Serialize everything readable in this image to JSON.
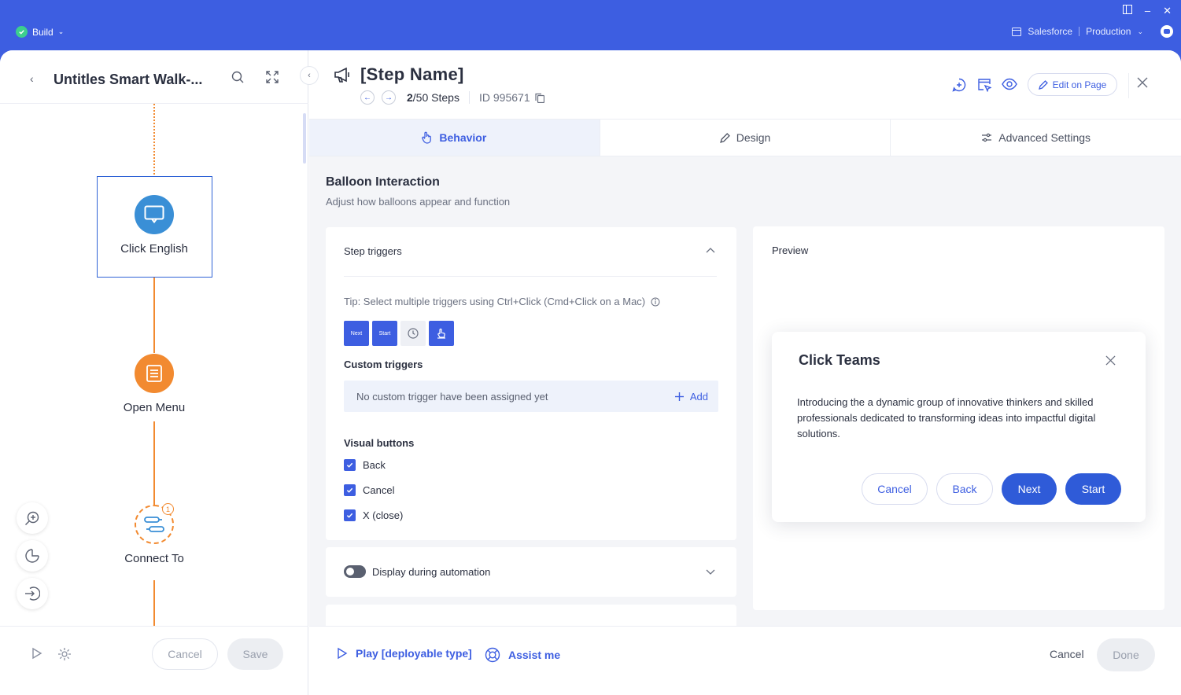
{
  "window": {
    "mode_label": "Build",
    "system_label": "Salesforce",
    "environment_label": "Production"
  },
  "left": {
    "title": "Untitles Smart Walk-...",
    "nodes": [
      {
        "label": "Click English",
        "icon": "balloon-icon"
      },
      {
        "label": "Open Menu",
        "icon": "list-icon"
      },
      {
        "label": "Connect To",
        "icon": "connector-icon",
        "badge": "1"
      }
    ],
    "footer": {
      "cancel": "Cancel",
      "save": "Save"
    }
  },
  "step": {
    "name": "[Step Name]",
    "current": "2",
    "total_label": "/50 Steps",
    "id_label": "ID 995671",
    "edit_on_page": "Edit on Page"
  },
  "tabs": [
    {
      "label": "Behavior",
      "active": true
    },
    {
      "label": "Design",
      "active": false
    },
    {
      "label": "Advanced Settings",
      "active": false
    }
  ],
  "section": {
    "title": "Balloon Interaction",
    "subtitle": "Adjust how balloons appear and function"
  },
  "step_triggers": {
    "title": "Step triggers",
    "tip": "Tip: Select multiple triggers using Ctrl+Click (Cmd+Click on a Mac)",
    "buttons": [
      {
        "label": "Next",
        "selected": true
      },
      {
        "label": "Start",
        "selected": true
      },
      {
        "label": "",
        "icon": "clock-icon",
        "selected": false
      },
      {
        "label": "",
        "icon": "click-element-icon",
        "selected": true
      }
    ],
    "custom_label": "Custom triggers",
    "custom_empty": "No custom trigger have been assigned yet",
    "add_label": "Add",
    "visual_label": "Visual buttons",
    "visual_buttons": [
      {
        "label": "Back",
        "checked": true
      },
      {
        "label": "Cancel",
        "checked": true
      },
      {
        "label": "X (close)",
        "checked": true
      }
    ]
  },
  "automation": {
    "label": "Display during automation",
    "enabled": false
  },
  "preview": {
    "label": "Preview",
    "balloon": {
      "title": "Click Teams",
      "text": "Introducing the a dynamic group of innovative thinkers and skilled professionals dedicated to transforming ideas into impactful digital solutions.",
      "buttons": {
        "cancel": "Cancel",
        "back": "Back",
        "next": "Next",
        "start": "Start"
      }
    }
  },
  "footer": {
    "play": "Play [deployable type]",
    "assist": "Assist me",
    "cancel": "Cancel",
    "done": "Done"
  },
  "colors": {
    "brand": "#3d5ee1",
    "accent_orange": "#f28a30",
    "node_blue": "#3a8fd6",
    "success": "#3ccf8e"
  }
}
